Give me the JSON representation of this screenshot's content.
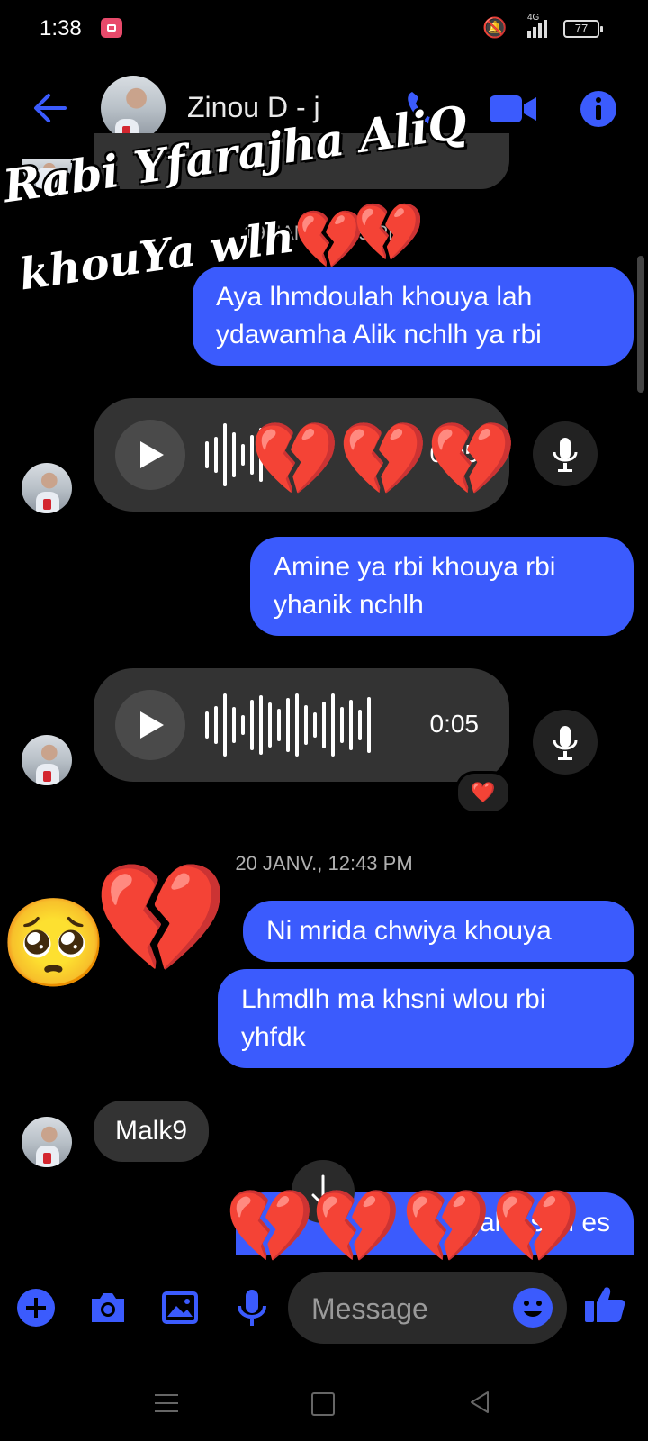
{
  "status_bar": {
    "time": "1:38",
    "network": "4G",
    "battery": "77"
  },
  "header": {
    "contact_name": "Zinou D - j"
  },
  "overlay": {
    "line1": "Rabi Yfarajha AliQ",
    "line2": "khouYa wlh"
  },
  "messages": {
    "date_1": "19 JANV. 2:59 PM",
    "out_1": "Aya lhmdoulah khouya lah ydawamha Alik nchlh ya rbi",
    "audio_1": {
      "duration": "0:05"
    },
    "out_2": "Amine ya rbi khouya rbi yhanik nchlh",
    "audio_2": {
      "duration": "0:05",
      "reaction": "❤️"
    },
    "date_2": "20 JANV., 12:43 PM",
    "out_3": "Ni mrida chwiya khouya",
    "out_4": "Lhmdlh ma khsni wlou rbi yhfdk",
    "in_1": "Malk9",
    "out_5_partial": "gal  e s m  es"
  },
  "composer": {
    "placeholder": "Message"
  },
  "colors": {
    "accent": "#3b5bfd",
    "incoming": "#333333",
    "background": "#000000"
  },
  "icons": [
    "back-icon",
    "phone-icon",
    "video-camera-icon",
    "info-icon",
    "plus-icon",
    "camera-icon",
    "gallery-icon",
    "microphone-icon",
    "emoji-icon",
    "thumbs-up-icon",
    "arrow-down-icon",
    "play-icon",
    "broken-heart-icon",
    "pleading-face-icon"
  ]
}
